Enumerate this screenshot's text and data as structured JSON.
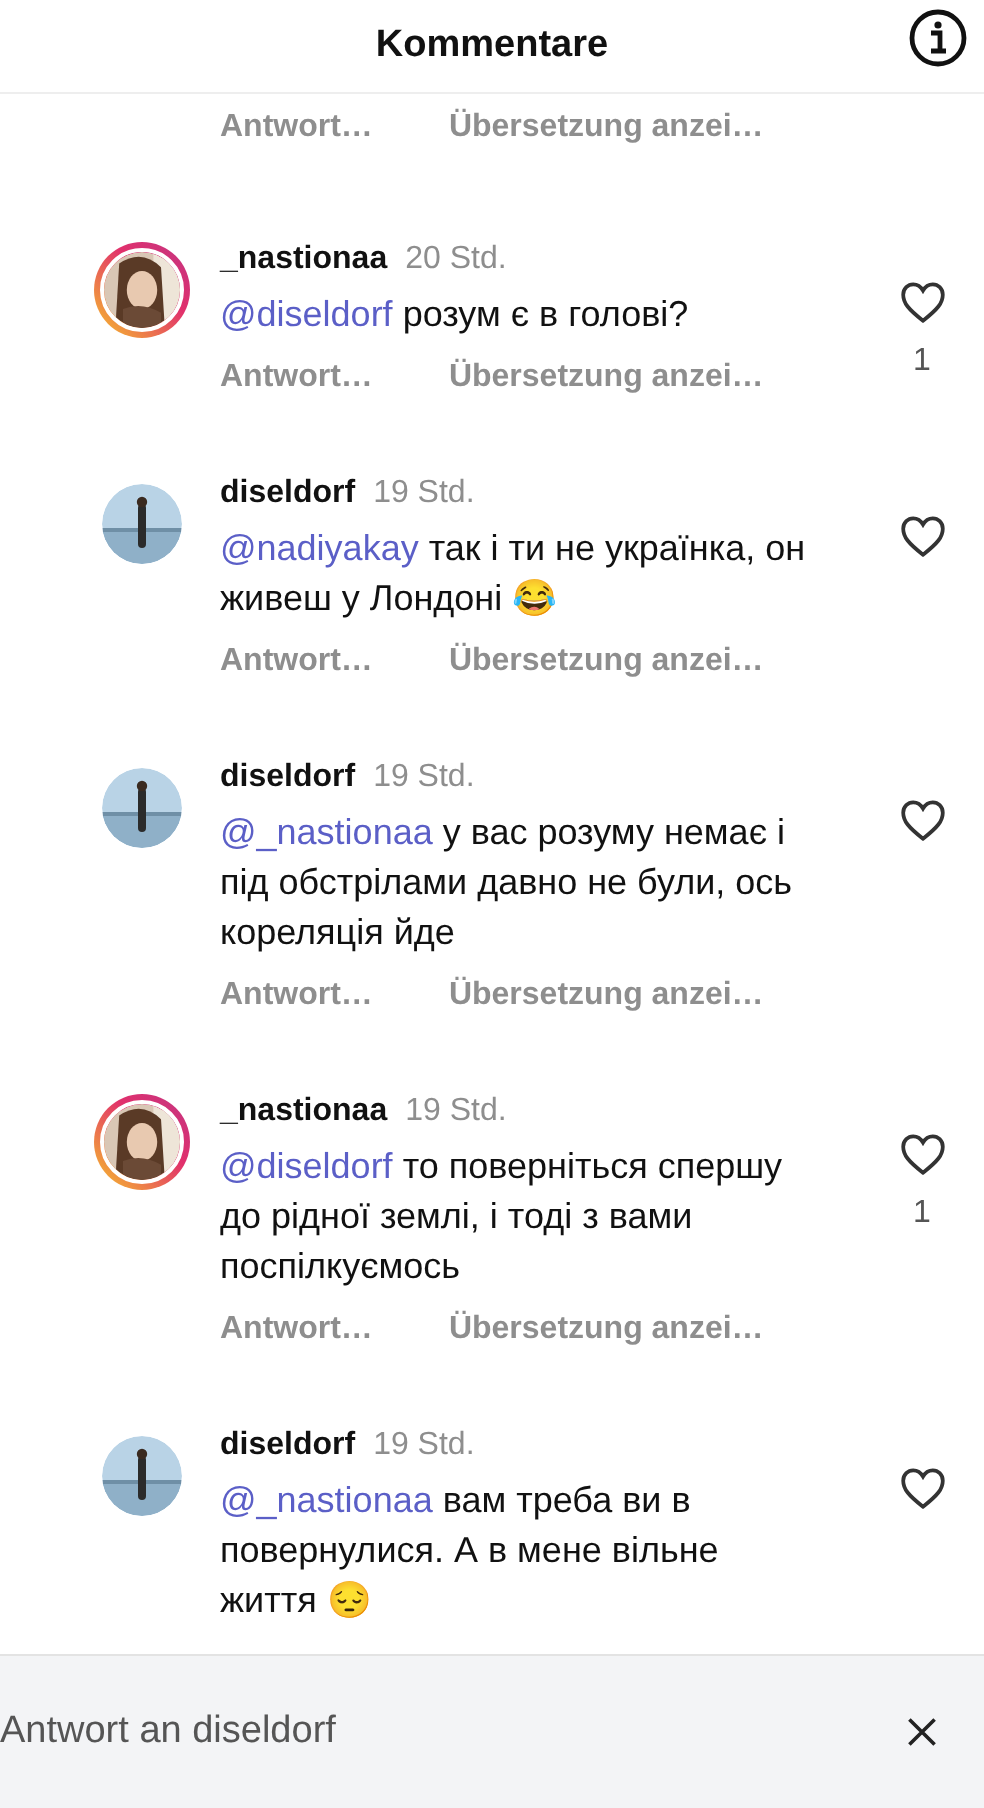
{
  "header": {
    "title": "Kommentare"
  },
  "partial_comment": {
    "actions": [
      "Antwort…",
      "Übersetzung anzei…"
    ]
  },
  "comments": [
    {
      "username": "_nastionaa",
      "time": "20 Std.",
      "story_ring": true,
      "mention": "@diseldorf",
      "text": "розум є в голові?",
      "likes": "1",
      "actions": [
        "Antwort…",
        "Übersetzung anzei…"
      ]
    },
    {
      "username": "diseldorf",
      "time": "19 Std.",
      "story_ring": false,
      "mention": "@nadiyakay",
      "text": "так і ти не українка, он живеш у Лондоні 😂",
      "actions": [
        "Antwort…",
        "Übersetzung anzei…"
      ]
    },
    {
      "username": "diseldorf",
      "time": "19 Std.",
      "story_ring": false,
      "mention": "@_nastionaa",
      "text": "у вас розуму немає і під обстрілами давно не були, ось кореляція йде",
      "actions": [
        "Antwort…",
        "Übersetzung anzei…"
      ]
    },
    {
      "username": "_nastionaa",
      "time": "19 Std.",
      "story_ring": true,
      "mention": "@diseldorf",
      "text": "то поверніться спершу до рідної землі, і тоді з вами поспілкуємось",
      "likes": "1",
      "actions": [
        "Antwort…",
        "Übersetzung anzei…"
      ]
    },
    {
      "username": "diseldorf",
      "time": "19 Std.",
      "story_ring": false,
      "mention": "@_nastionaa",
      "text": "вам треба ви в повернулися. А в мене вільне життя 😔"
    }
  ],
  "reply_bar": {
    "text": "Antwort an diseldorf"
  }
}
